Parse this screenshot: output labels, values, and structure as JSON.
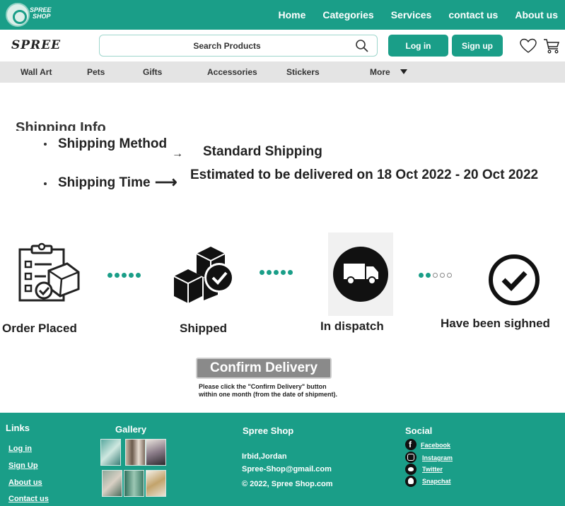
{
  "header": {
    "logo_text_line1": "SPREE",
    "logo_text_line2": "SHOP",
    "nav": [
      "Home",
      "Categories",
      "Services",
      "contact us",
      "About us"
    ]
  },
  "toolbar": {
    "brand": "SPREE",
    "search_placeholder": "Search Products",
    "login_label": "Log in",
    "signup_label": "Sign up"
  },
  "categories": [
    "Wall Art",
    "Pets",
    "Gifts",
    "Accessories",
    "Stickers",
    "More"
  ],
  "shipping": {
    "title": "Shipping Info",
    "method_label": "Shipping Method",
    "method_arrow": "→",
    "method_value": "Standard Shipping",
    "time_label": "Shipping Time",
    "time_arrow": "⟶",
    "time_value": "Estimated to be delivered on 18 Oct 2022 - 20 Oct 2022"
  },
  "steps": [
    {
      "label": "Order Placed",
      "icon": "clipboard-check-icon"
    },
    {
      "label": "Shipped",
      "icon": "boxes-check-icon"
    },
    {
      "label": "In dispatch",
      "icon": "truck-icon"
    },
    {
      "label": "Have been sighned",
      "icon": "check-circle-icon"
    }
  ],
  "confirm": {
    "button_label": "Confirm Delivery",
    "note": "Please click the \"Confirm Delivery\" button within one month (from the date of shipment)."
  },
  "footer": {
    "links_heading": "Links",
    "links": [
      "Log in",
      "Sign Up",
      "About us",
      "Contact us"
    ],
    "gallery_heading": "Gallery",
    "shop_heading": "Spree Shop",
    "address": "Irbid,Jordan",
    "email": "Spree-Shop@gmail.com",
    "copyright": "© 2022, Spree Shop.com",
    "social_heading": "Social",
    "social": [
      "Facebook",
      "Instagram",
      "Twitter",
      "Snapchat"
    ]
  },
  "colors": {
    "brand": "#1a9e88",
    "category_bar": "#e4e4e4",
    "confirm_button": "#8a8a8a"
  }
}
